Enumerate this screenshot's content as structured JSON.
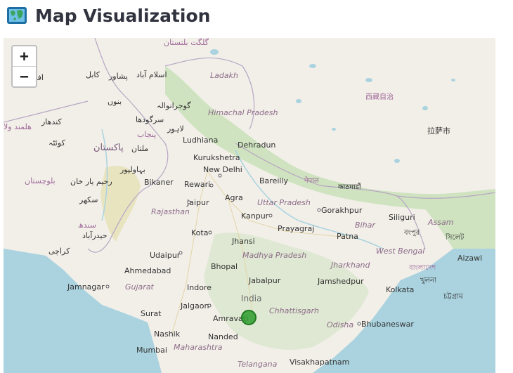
{
  "page": {
    "title": "Map Visualization"
  },
  "map": {
    "zoom_in_label": "+",
    "zoom_out_label": "−",
    "marker_color": "#2e9c2e",
    "cities": [
      {
        "name": "Ludhiana"
      },
      {
        "name": "Kurukshetra"
      },
      {
        "name": "Dehradun"
      },
      {
        "name": "New Delhi"
      },
      {
        "name": "Bareilly"
      },
      {
        "name": "Bikaner"
      },
      {
        "name": "Rewari"
      },
      {
        "name": "Agra"
      },
      {
        "name": "Jaipur"
      },
      {
        "name": "Kanpur"
      },
      {
        "name": "Gorakhpur"
      },
      {
        "name": "Siliguri"
      },
      {
        "name": "Prayagraj"
      },
      {
        "name": "Kota"
      },
      {
        "name": "Jhansi"
      },
      {
        "name": "Patna"
      },
      {
        "name": "Udaipur"
      },
      {
        "name": "Ahmedabad"
      },
      {
        "name": "Bhopal"
      },
      {
        "name": "Jamnagar"
      },
      {
        "name": "Indore"
      },
      {
        "name": "Jabalpur"
      },
      {
        "name": "Jamshedpur"
      },
      {
        "name": "Kolkata"
      },
      {
        "name": "Jalgaon"
      },
      {
        "name": "Surat"
      },
      {
        "name": "Amravati"
      },
      {
        "name": "Nashik"
      },
      {
        "name": "Nanded"
      },
      {
        "name": "Bhubaneswar"
      },
      {
        "name": "Mumbai"
      },
      {
        "name": "Visakhapatnam"
      },
      {
        "name": "Aizawl"
      }
    ],
    "regions": [
      {
        "name": "Ladakh"
      },
      {
        "name": "Himachal Pradesh"
      },
      {
        "name": "Uttar Pradesh"
      },
      {
        "name": "Rajasthan"
      },
      {
        "name": "Bihar"
      },
      {
        "name": "Madhya Pradesh"
      },
      {
        "name": "Jharkhand"
      },
      {
        "name": "West Bengal"
      },
      {
        "name": "Gujarat"
      },
      {
        "name": "Chhattisgarh"
      },
      {
        "name": "Odisha"
      },
      {
        "name": "Maharashtra"
      },
      {
        "name": "Telangana"
      },
      {
        "name": "Assam"
      }
    ],
    "country_label": "India",
    "foreign_labels": [
      {
        "text": "اسلام آباد"
      },
      {
        "text": "پشاور"
      },
      {
        "text": "کابل"
      },
      {
        "text": "بنوں"
      },
      {
        "text": "گوجرانوالہ"
      },
      {
        "text": "سرگودھا"
      },
      {
        "text": "لاہور"
      },
      {
        "text": "پنجاب"
      },
      {
        "text": "کندھار"
      },
      {
        "text": "کوئٹہ"
      },
      {
        "text": "ملتان"
      },
      {
        "text": "پاکستان"
      },
      {
        "text": "بہاولپور"
      },
      {
        "text": "رحیم یار خان"
      },
      {
        "text": "بلوچستان"
      },
      {
        "text": "سکھر"
      },
      {
        "text": "سندھ"
      },
      {
        "text": "حیدرآباد"
      },
      {
        "text": "کراچی"
      },
      {
        "text": "افغا"
      },
      {
        "text": "ھلمند ولا"
      },
      {
        "text": "گلگت بلتستان"
      },
      {
        "text": "西藏自治"
      },
      {
        "text": "拉萨市"
      },
      {
        "text": "नेपाल"
      },
      {
        "text": "काठमाडौं"
      },
      {
        "text": "বাংলাদেশ"
      },
      {
        "text": "খুলনা"
      },
      {
        "text": "চট্টগ্রাম"
      },
      {
        "text": "সিলেট"
      },
      {
        "text": "বংপুর"
      }
    ]
  }
}
